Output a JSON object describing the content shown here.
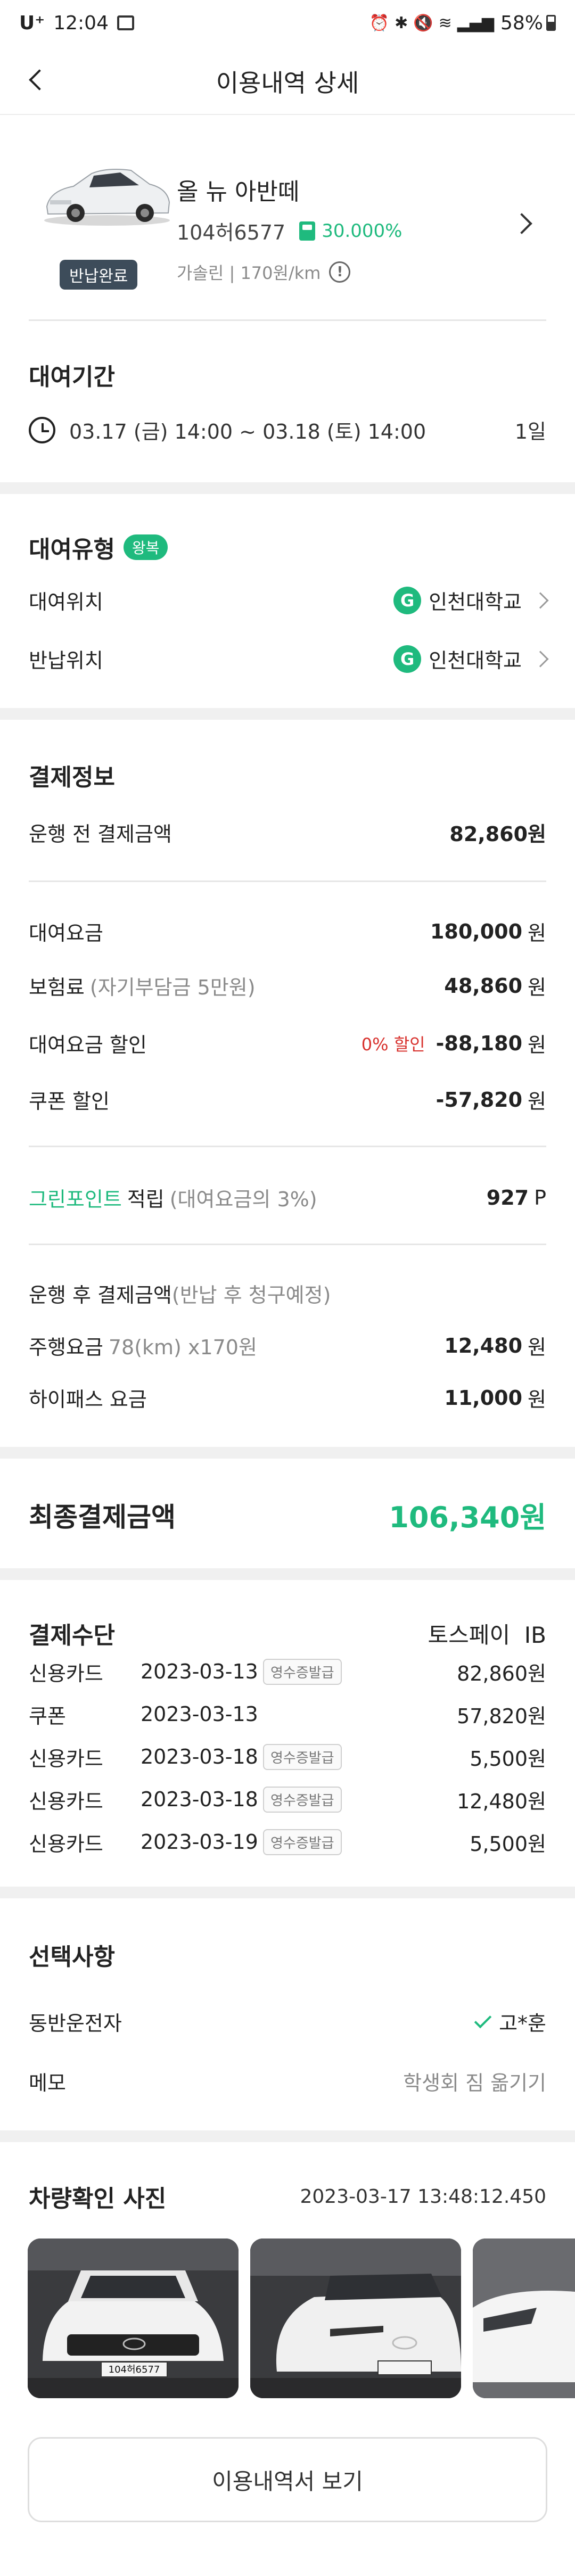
{
  "status_bar": {
    "carrier": "U⁺",
    "time": "12:04",
    "battery": "58%"
  },
  "header": {
    "title": "이용내역 상세"
  },
  "car": {
    "name": "올 뉴 아반떼",
    "plate": "104허6577",
    "fuel_level": "30.000%",
    "fuel_info": "가솔린 | 170원/km",
    "status_badge": "반납완료"
  },
  "rental_period": {
    "title": "대여기간",
    "range": "03.17 (금) 14:00 ~ 03.18 (토) 14:00",
    "days": "1일"
  },
  "rental_type": {
    "title": "대여유형",
    "badge": "왕복",
    "pickup_label": "대여위치",
    "pickup_value": "인천대학교",
    "return_label": "반납위치",
    "return_value": "인천대학교",
    "location_icon_letter": "G"
  },
  "payment_info": {
    "title": "결제정보",
    "pre_label": "운행 전 결제금액",
    "pre_value": "82,860원",
    "fee_label": "대여요금",
    "fee_value": "180,000",
    "insurance_label": "보험료",
    "insurance_note": "(자기부담금 5만원)",
    "insurance_value": "48,860",
    "discount_label": "대여요금 할인",
    "discount_badge": "0% 할인",
    "discount_value": "-88,180",
    "coupon_label": "쿠폰 할인",
    "coupon_value": "-57,820",
    "won": "원",
    "green_point_label": "그린포인트",
    "green_point_suffix": "적립",
    "green_point_note": "(대여요금의 3%)",
    "green_point_value": "927",
    "point_unit": "P",
    "post_label": "운행 후 결제금액",
    "post_note": "(반납 후 청구예정)",
    "mileage_label": "주행요금",
    "mileage_note": "78(km) x170원",
    "mileage_value": "12,480",
    "hipass_label": "하이패스 요금",
    "hipass_value": "11,000"
  },
  "final": {
    "label": "최종결제금액",
    "value": "106,340원"
  },
  "payment_methods": {
    "title": "결제수단",
    "provider": "토스페이  IB",
    "receipt_label": "영수증발급",
    "rows": [
      {
        "method": "신용카드",
        "date": "2023-03-13",
        "amount": "82,860원"
      },
      {
        "method": "쿠폰",
        "date": "2023-03-13",
        "amount": "57,820원"
      },
      {
        "method": "신용카드",
        "date": "2023-03-18",
        "amount": "5,500원"
      },
      {
        "method": "신용카드",
        "date": "2023-03-18",
        "amount": "12,480원"
      },
      {
        "method": "신용카드",
        "date": "2023-03-19",
        "amount": "5,500원"
      }
    ]
  },
  "options": {
    "title": "선택사항",
    "driver_label": "동반운전자",
    "driver_value": "고*훈",
    "memo_label": "메모",
    "memo_value": "학생회 짐 옮기기"
  },
  "photos": {
    "title": "차량확인 사진",
    "timestamp": "2023-03-17 13:48:12.450",
    "plate_text": "104허6577"
  },
  "footer": {
    "view_button": "이용내역서 보기"
  },
  "colors": {
    "accent": "#1fba7e",
    "discount_red": "#d8322e"
  }
}
